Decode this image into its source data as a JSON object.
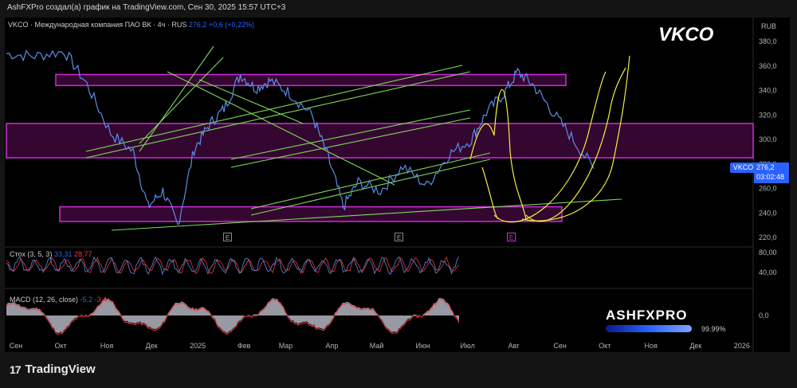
{
  "header": {
    "text": "AshFXPro создал(а) график на TradingView.com, Сен 30, 2025 15:57 UTC+3"
  },
  "legend": {
    "main": "VKCO · Международная компания ПАО ВК · 4ч · RUS",
    "price": "276,2",
    "change": "+0,6 (+0,22%)"
  },
  "overlay_title": "VKCO",
  "price_axis": {
    "currency": "RUB",
    "ticks": [
      "380,0",
      "360,0",
      "340,0",
      "320,0",
      "300,0",
      "280,0",
      "260,0",
      "240,0",
      "220,0"
    ]
  },
  "price_label": {
    "symbol": "VKCO",
    "price": "276,2",
    "countdown": "03:02:48"
  },
  "stoch": {
    "name": "Стох (3, 5, 3)",
    "k": "33,31",
    "d": "28,77",
    "ticks": [
      "80,00",
      "40,00"
    ]
  },
  "macd": {
    "name": "MACD (12, 26, close)",
    "macd": "-5,2",
    "signal": "-3,4",
    "tick": "0,0"
  },
  "time_axis": [
    "Сен",
    "Окт",
    "Ноя",
    "Дек",
    "2025",
    "Фев",
    "Мар",
    "Апр",
    "Май",
    "Июн",
    "Июл",
    "Авг",
    "Сен",
    "Окт",
    "Ноя",
    "Дек",
    "2026"
  ],
  "watermark": {
    "text": "ASHFXPRO",
    "pct": "99.99%"
  },
  "footer": {
    "brand": "TradingView"
  },
  "events": [
    "E",
    "E",
    "E"
  ],
  "colors": {
    "price_line": "#5b8ee6",
    "zones": "#d02dd8",
    "trend": "#7ed957",
    "projection": "#f0f040",
    "macd_up": "#b2b5be",
    "macd_line": "#f23645"
  },
  "chart_data": {
    "type": "line",
    "title": "VKCO",
    "xlabel": "",
    "ylabel": "",
    "ylim": [
      215,
      390
    ],
    "series": [
      {
        "name": "VKCO",
        "x": [
          "2024-09-01",
          "2024-09-20",
          "2024-10-10",
          "2024-10-25",
          "2024-11-10",
          "2024-11-25",
          "2024-12-05",
          "2024-12-15",
          "2024-12-25",
          "2025-01-05",
          "2025-01-15",
          "2025-01-25",
          "2025-02-05",
          "2025-02-15",
          "2025-02-25",
          "2025-03-10",
          "2025-03-25",
          "2025-04-05",
          "2025-04-15",
          "2025-04-25",
          "2025-05-10",
          "2025-05-25",
          "2025-06-10",
          "2025-06-25",
          "2025-07-10",
          "2025-07-20",
          "2025-08-01",
          "2025-08-10",
          "2025-08-20",
          "2025-09-01",
          "2025-09-15",
          "2025-09-30"
        ],
        "values": [
          370,
          368,
          372,
          345,
          305,
          290,
          245,
          258,
          230,
          292,
          312,
          325,
          353,
          342,
          348,
          338,
          320,
          285,
          245,
          265,
          258,
          278,
          262,
          288,
          300,
          322,
          338,
          355,
          345,
          325,
          302,
          276.2
        ]
      }
    ],
    "zones": [
      [
        344,
        353
      ],
      [
        285,
        313
      ],
      [
        233,
        245
      ]
    ],
    "grid": false,
    "legend": "top-left"
  }
}
